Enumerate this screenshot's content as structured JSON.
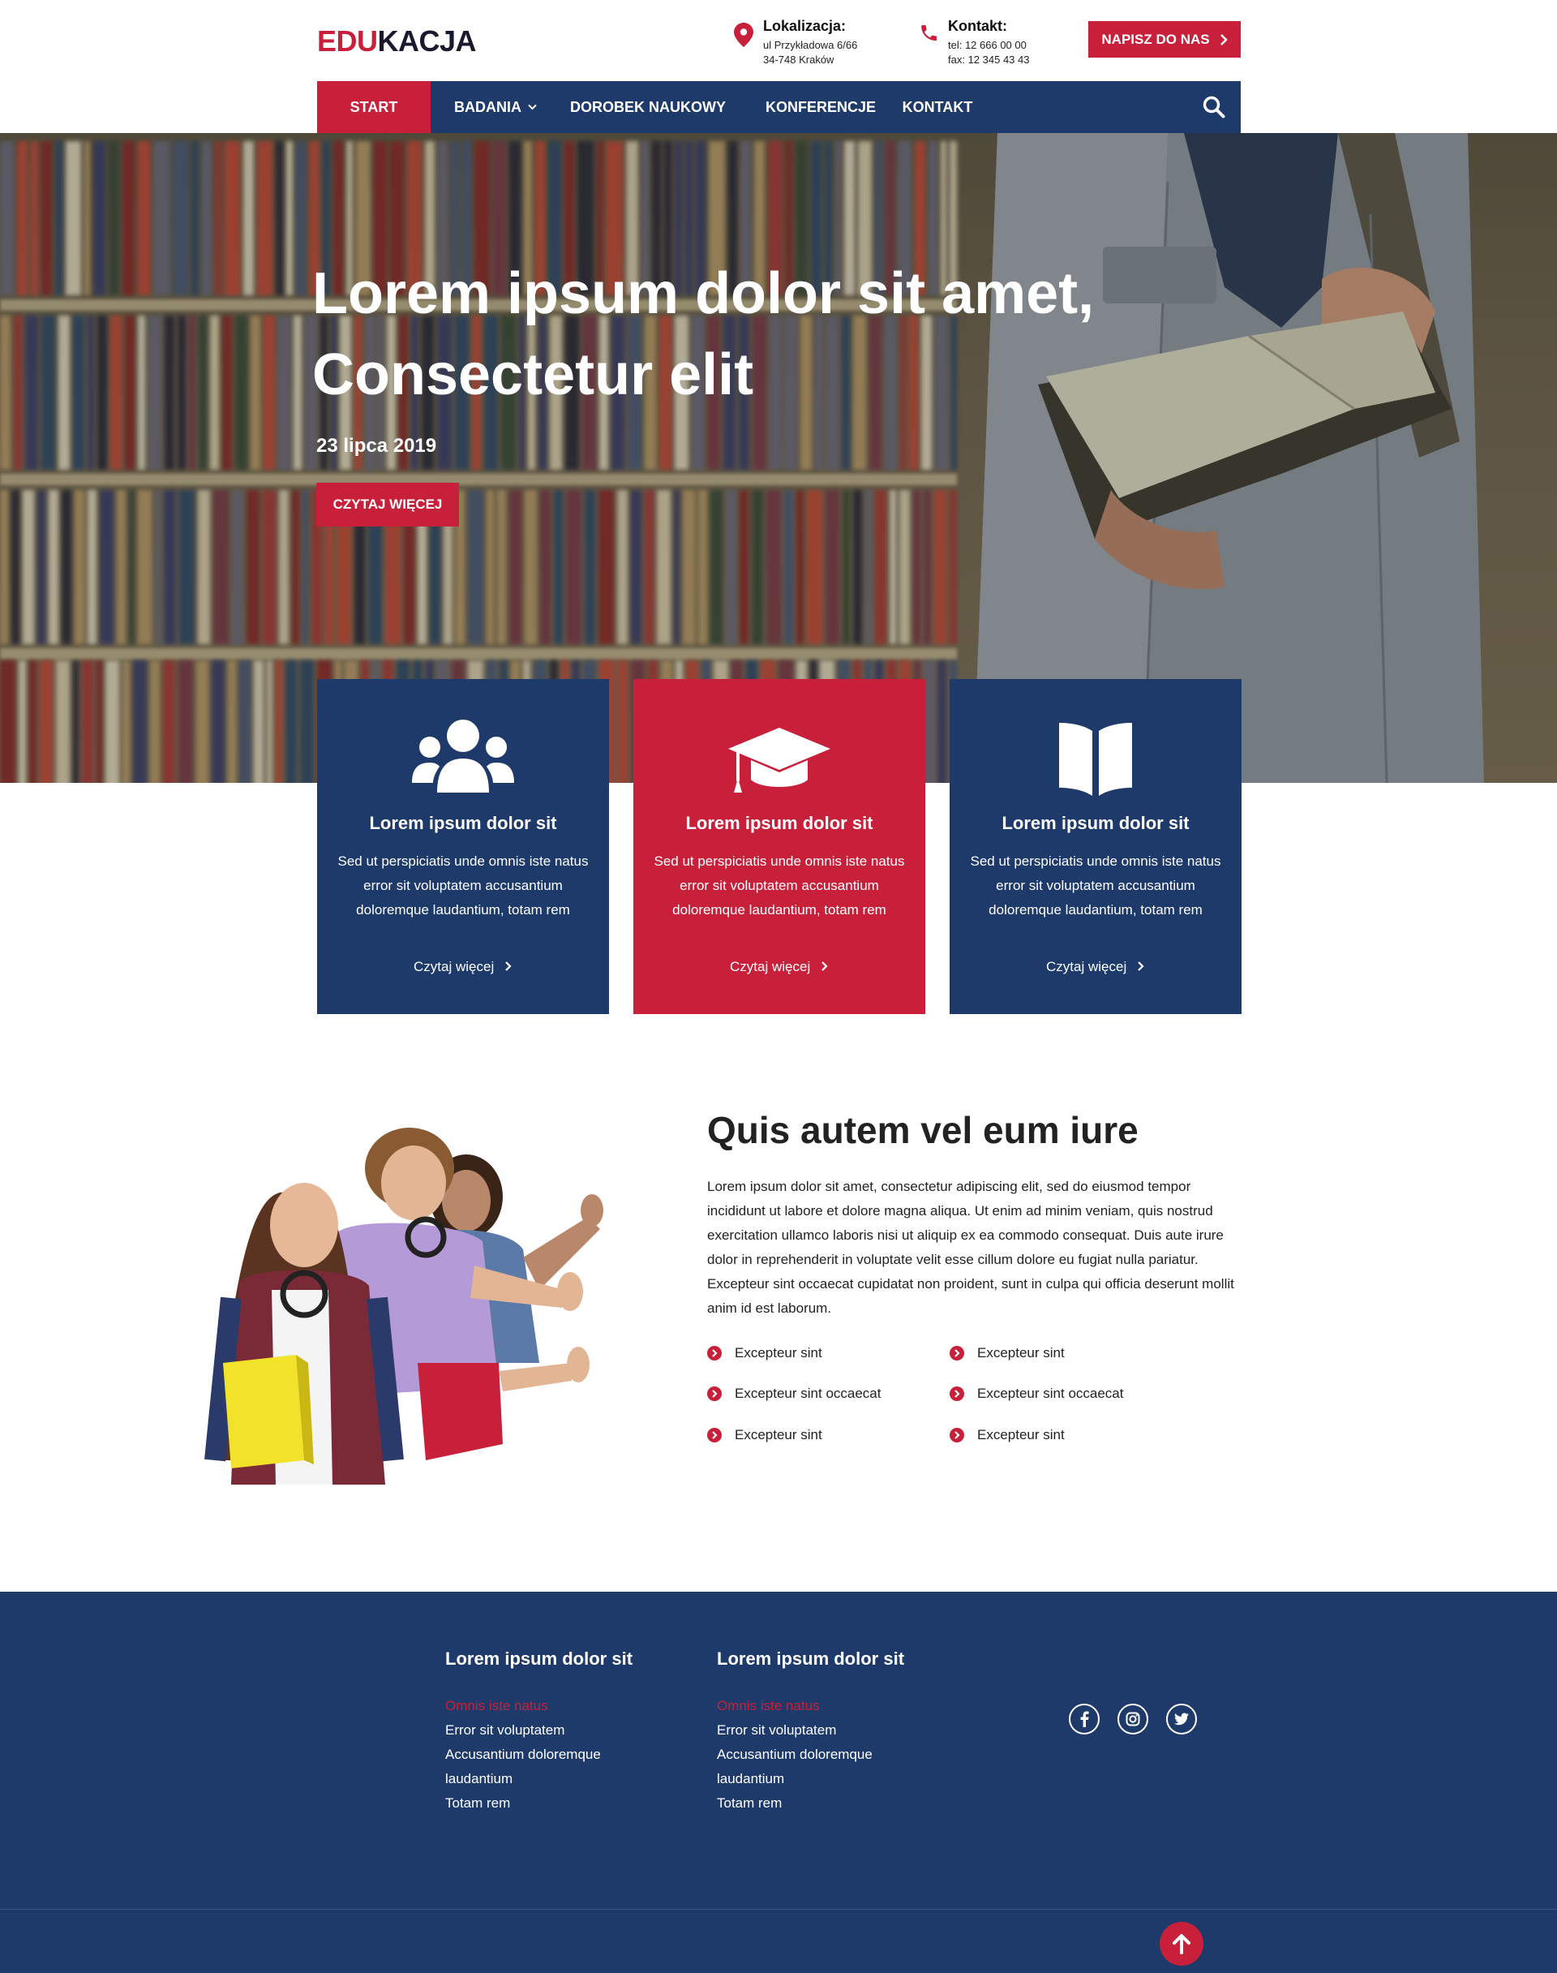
{
  "logo": {
    "part1": "EDU",
    "part2": "KACJA"
  },
  "header": {
    "location": {
      "title": "Lokalizacja:",
      "line1": "ul Przykładowa 6/66",
      "line2": "34-748 Kraków"
    },
    "contact": {
      "title": "Kontakt:",
      "line1": "tel: 12 666 00 00",
      "line2": "fax: 12 345 43 43"
    },
    "write_button": "NAPISZ DO NAS",
    "icons": {
      "location": "map-pin-icon",
      "phone": "phone-icon",
      "arrow": "chevron-right-icon"
    }
  },
  "nav": {
    "items": [
      {
        "label": "START",
        "active": true
      },
      {
        "label": "BADANIA",
        "dropdown": true
      },
      {
        "label": "DOROBEK NAUKOWY"
      },
      {
        "label": "KONFERENCJE"
      },
      {
        "label": "KONTAKT"
      }
    ],
    "search_icon": "search-icon"
  },
  "hero": {
    "title_line1": "Lorem ipsum dolor sit amet,",
    "title_line2": "Consectetur elit",
    "date": "23 lipca 2019",
    "button": "CZYTAJ WIĘCEJ"
  },
  "cards": [
    {
      "icon": "users-icon",
      "title": "Lorem ipsum dolor sit",
      "text": "Sed ut perspiciatis unde omnis iste natus error sit voluptatem accusantium doloremque laudantium, totam rem",
      "link": "Czytaj więcej",
      "color": "#1d3a6a"
    },
    {
      "icon": "graduation-cap-icon",
      "title": "Lorem ipsum dolor sit",
      "text": "Sed ut perspiciatis unde omnis iste natus error sit voluptatem accusantium doloremque laudantium, totam rem",
      "link": "Czytaj więcej",
      "color": "#c8203a"
    },
    {
      "icon": "open-book-icon",
      "title": "Lorem ipsum dolor sit",
      "text": "Sed ut perspiciatis unde omnis iste natus error sit voluptatem accusantium doloremque laudantium, totam rem",
      "link": "Czytaj więcej",
      "color": "#1d3a6a"
    }
  ],
  "about": {
    "title": "Quis autem vel eum iure",
    "text": "Lorem ipsum dolor sit amet, consectetur adipiscing elit, sed do eiusmod tempor incididunt ut labore et dolore magna aliqua. Ut enim ad minim veniam, quis nostrud exercitation ullamco laboris nisi ut aliquip ex ea commodo consequat. Duis aute irure dolor in reprehenderit in voluptate velit esse cillum dolore eu fugiat nulla pariatur. Excepteur sint occaecat cupidatat non proident, sunt in culpa qui officia deserunt mollit anim id est laborum.",
    "features": [
      "Excepteur sint",
      "Excepteur sint",
      "Excepteur sint occaecat",
      "Excepteur sint occaecat",
      "Excepteur sint",
      "Excepteur sint"
    ]
  },
  "footer": {
    "columns": [
      {
        "title": "Lorem ipsum dolor sit",
        "links": [
          "Omnis iste natus",
          "Error sit voluptatem",
          "Accusantium doloremque",
          "laudantium",
          "Totam rem"
        ]
      },
      {
        "title": "Lorem ipsum dolor sit",
        "links": [
          "Omnis iste natus",
          "Error sit voluptatem",
          "Accusantium doloremque",
          "laudantium",
          "Totam rem"
        ]
      }
    ],
    "social": [
      "facebook-icon",
      "instagram-icon",
      "twitter-icon"
    ],
    "to_top_icon": "arrow-up-icon"
  },
  "colors": {
    "primary_blue": "#1d3a6a",
    "accent_red": "#c8203a"
  }
}
